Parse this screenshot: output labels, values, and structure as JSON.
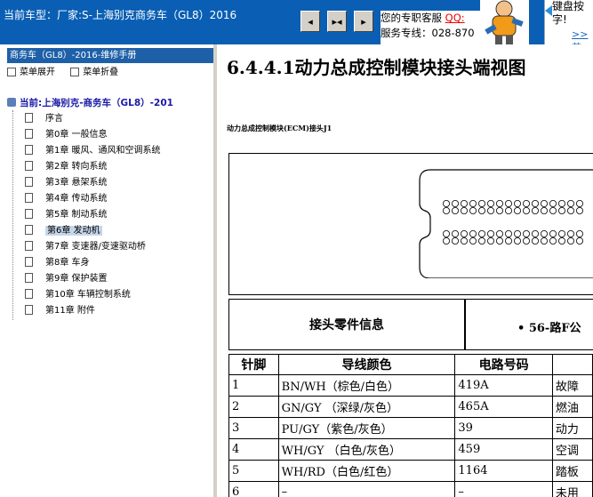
{
  "header": {
    "car_model": "当前车型：厂家:S-上海别克商务车（GL8）2016",
    "service_line1": "您的专职客服",
    "qq_label": "QQ:",
    "service_line2": "服务专线：028-870",
    "tip_text": "键盘按字!",
    "tip_more": ">>萘"
  },
  "nav_buttons": [
    {
      "glyph": "◂"
    },
    {
      "glyph": "▸◂"
    },
    {
      "glyph": "▸"
    }
  ],
  "sidebar": {
    "manual_title": "商务车（GL8）-2016-维修手册",
    "expand_label": "菜单展开",
    "collapse_label": "菜单折叠",
    "root_label": "当前:上海别克-商务车（GL8）-201",
    "items": [
      {
        "label": "序言"
      },
      {
        "label": "第0章 一般信息"
      },
      {
        "label": "第1章 暖风、通风和空调系统"
      },
      {
        "label": "第2章 转向系统"
      },
      {
        "label": "第3章 悬架系统"
      },
      {
        "label": "第4章 传动系统"
      },
      {
        "label": "第5章 制动系统"
      },
      {
        "label": "第6章 发动机",
        "selected": true
      },
      {
        "label": "第7章 变速器/变速驱动桥"
      },
      {
        "label": "第8章 车身"
      },
      {
        "label": "第9章 保护装置"
      },
      {
        "label": "第10章 车辆控制系统"
      },
      {
        "label": "第11章 附件"
      }
    ]
  },
  "content": {
    "section_title": "6.4.4.1动力总成控制模块接头端视图",
    "connector_caption": "动力总成控制模块(ECM)接头J1",
    "info_label": "接头零件信息",
    "info_bullet": "56-路F公",
    "info_dot": "•",
    "table_headers": [
      "针脚",
      "导线颜色",
      "电路号码",
      ""
    ],
    "rows": [
      {
        "pin": "1",
        "color": "BN/WH（棕色/白色）",
        "circuit": "419A",
        "func": "故障"
      },
      {
        "pin": "2",
        "color": "GN/GY （深绿/灰色）",
        "circuit": "465A",
        "func": "燃油"
      },
      {
        "pin": "3",
        "color": "PU/GY（紫色/灰色）",
        "circuit": "39",
        "func": "动力"
      },
      {
        "pin": "4",
        "color": "WH/GY （白色/灰色）",
        "circuit": "459",
        "func": "空调"
      },
      {
        "pin": "5",
        "color": "WH/RD（白色/红色）",
        "circuit": "1164",
        "func": "踏板"
      },
      {
        "pin": "6",
        "color": "–",
        "circuit": "–",
        "func": "未用"
      }
    ]
  },
  "colors": {
    "title_bar": "#0a5fb4",
    "sidebar_header": "#1e60a8",
    "tree_root": "#1a1aa6",
    "qq_red": "#e00000"
  }
}
